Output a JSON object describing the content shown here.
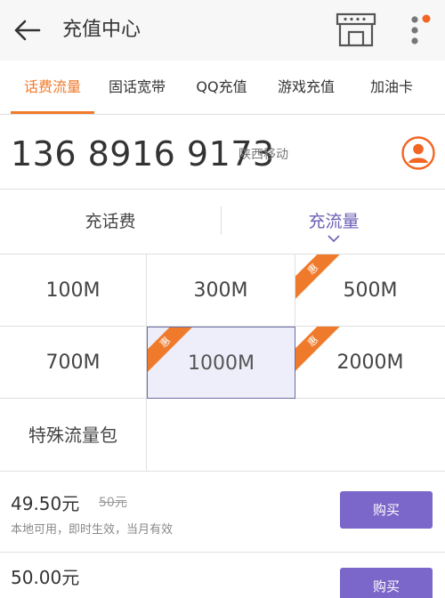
{
  "appbar": {
    "title": "充值中心"
  },
  "tabs": [
    {
      "label": "话费流量",
      "active": true
    },
    {
      "label": "固话宽带",
      "active": false
    },
    {
      "label": "QQ充值",
      "active": false
    },
    {
      "label": "游戏充值",
      "active": false
    },
    {
      "label": "加油卡",
      "active": false
    }
  ],
  "phone": {
    "number": "136 8916 9173",
    "carrier": "陕西移动"
  },
  "subtabs": [
    {
      "label": "充话费",
      "active": false
    },
    {
      "label": "充流量",
      "active": true
    }
  ],
  "packages": [
    {
      "label": "100M",
      "promo": false,
      "selected": false
    },
    {
      "label": "300M",
      "promo": false,
      "selected": false
    },
    {
      "label": "500M",
      "promo": true,
      "selected": false
    },
    {
      "label": "700M",
      "promo": false,
      "selected": false
    },
    {
      "label": "1000M",
      "promo": true,
      "selected": true
    },
    {
      "label": "2000M",
      "promo": true,
      "selected": false
    },
    {
      "label": "特殊流量包",
      "promo": false,
      "selected": false
    }
  ],
  "promo_badge": "惠",
  "offers": [
    {
      "price": "49.50元",
      "original": "50元",
      "desc": "本地可用，即时生效，当月有效",
      "buy_label": "购买"
    },
    {
      "price": "50.00元",
      "original": "",
      "desc": "",
      "buy_label": "购买"
    }
  ],
  "colors": {
    "accent": "#f07a2b",
    "buy": "#7b66c9",
    "selected_bg": "#eeeefb",
    "subtab_active": "#6b5fb5"
  }
}
